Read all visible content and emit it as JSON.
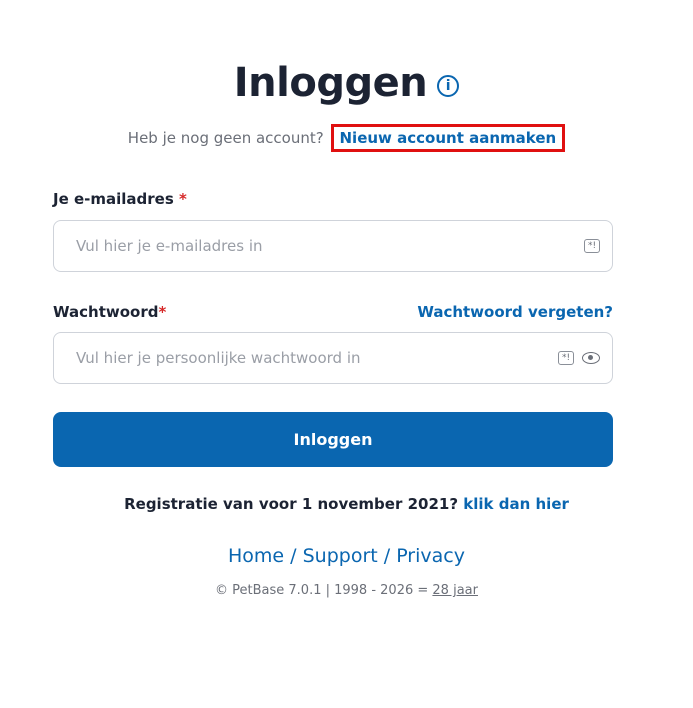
{
  "header": {
    "title": "Inloggen",
    "info_icon_glyph": "i",
    "info_icon": "info-icon"
  },
  "signup": {
    "prompt": "Heb je nog geen account?",
    "link": "Nieuw account aanmaken"
  },
  "email": {
    "label": "Je e-mailadres",
    "required_mark": "*",
    "placeholder": "Vul hier je e-mailadres in",
    "value": "",
    "icon": "password-manager-icon"
  },
  "password": {
    "label": "Wachtwoord",
    "required_mark": "*",
    "placeholder": "Vul hier je persoonlijke wachtwoord in",
    "value": "",
    "forgot_link": "Wachtwoord vergeten?",
    "icons": [
      "password-manager-icon",
      "eye-icon"
    ]
  },
  "submit": {
    "label": "Inloggen"
  },
  "legacy": {
    "text": "Registratie van voor 1 november 2021?",
    "link": "klik dan hier"
  },
  "footer": {
    "home": "Home",
    "separator": " / ",
    "support": "Support",
    "privacy": "Privacy",
    "copyright_text": "© PetBase 7.0.1 | 1998 - 2026 =",
    "years_link": "28 jaar"
  },
  "colors": {
    "primary": "#0a66b0",
    "text": "#1c2333",
    "muted": "#6b6f78",
    "required": "#d62828",
    "highlight_box": "#e01010"
  }
}
